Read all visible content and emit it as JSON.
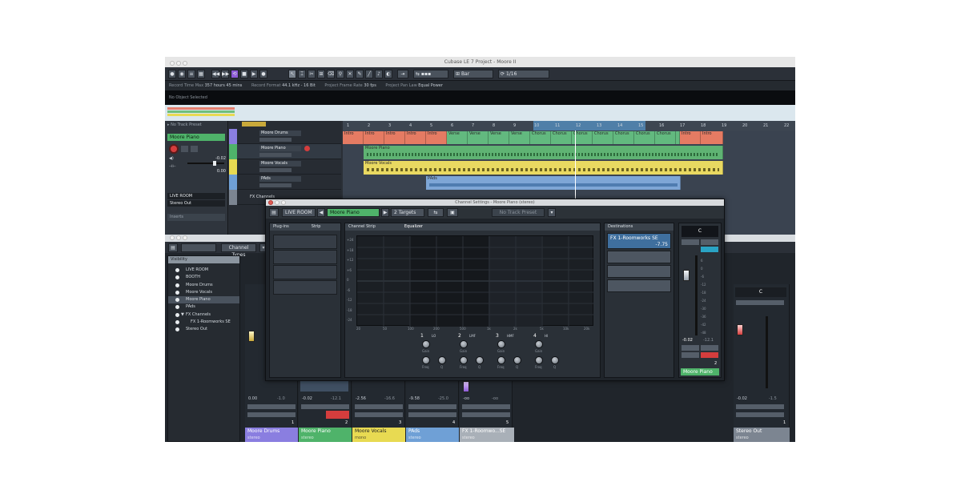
{
  "window": {
    "title": "Cubase LE 7 Project - Moore II"
  },
  "toolbar": {
    "snap_type": "Bar",
    "quantize": "1/16"
  },
  "info_line": {
    "items": [
      {
        "label": "Record Time Max",
        "value": "357 hours 45 mins"
      },
      {
        "label": "Record Format",
        "value": "44.1 kHz - 16 Bit"
      },
      {
        "label": "Project Frame Rate",
        "value": "30 fps"
      },
      {
        "label": "Project Pan Law",
        "value": "Equal Power"
      }
    ]
  },
  "object_selection": "No Object Selected",
  "inspector": {
    "preset": "No Track Preset",
    "track_name": "Moore Piano",
    "volume": "-0.02",
    "pan": "0.00",
    "routing_in": "LIVE ROOM",
    "routing_out": "Stereo Out",
    "inserts_label": "Inserts"
  },
  "tracks": [
    {
      "name": "Moore Drums",
      "color": "#8a7ee0"
    },
    {
      "name": "Moore Piano",
      "color": "#4fb36a"
    },
    {
      "name": "Moore Vocals",
      "color": "#e8da52"
    },
    {
      "name": "PAds",
      "color": "#6fa0d6"
    },
    {
      "name": "FX Channels",
      "color": "#7c8591"
    }
  ],
  "ruler": {
    "bars": [
      "1",
      "2",
      "3",
      "4",
      "5",
      "6",
      "7",
      "8",
      "9",
      "10",
      "11",
      "12",
      "13",
      "14",
      "15",
      "16",
      "17",
      "18",
      "19",
      "20",
      "21",
      "22"
    ]
  },
  "drum_parts": [
    "Intro",
    "Intro",
    "Intro",
    "Intro",
    "Intro",
    "Verse",
    "Verse",
    "Verse",
    "Verse",
    "Chorus",
    "Chorus",
    "Chorus",
    "Chorus",
    "Chorus",
    "Chorus",
    "Chorus",
    "Chorus",
    "Intro",
    "Intro"
  ],
  "piano_part": "Moore Piano",
  "vocals_part": "Moore Vocals",
  "pads_part": "PAds",
  "mixer": {
    "channel_types_label": "Channel Types",
    "visibility_title": "Visibility",
    "visibility_items": [
      "LIVE ROOM",
      "BOOTH",
      "Moore Drums",
      "Moore Vocals",
      "Moore Piano",
      "PAds",
      "FX Channels",
      "FX 1-Roomworks SE",
      "Stereo Out"
    ],
    "visibility_selected": 4,
    "channels": [
      {
        "name": "Moore Drums",
        "format": "stereo",
        "color": "#8a7ee0",
        "vol": "0.00",
        "peak": "-1.0",
        "num": "1"
      },
      {
        "name": "Moore Piano",
        "format": "stereo",
        "color": "#4fb36a",
        "vol": "-0.02",
        "peak": "-12.1",
        "num": "2"
      },
      {
        "name": "Moore Vocals",
        "format": "mono",
        "color": "#e8da52",
        "vol": "-2.56",
        "peak": "-16.6",
        "num": "3"
      },
      {
        "name": "PAds",
        "format": "stereo",
        "color": "#6fa0d6",
        "vol": "-9.58",
        "peak": "-25.0",
        "num": "4"
      },
      {
        "name": "FX 1-Roomwo...SE",
        "format": "stereo",
        "color": "#a9b0b8",
        "vol": "-oo",
        "peak": "-oo",
        "num": "5"
      }
    ],
    "stereo_out": {
      "name": "Stereo Out",
      "format": "stereo",
      "vol": "-0.02",
      "peak": "-1.5",
      "pan": "C",
      "num": "1"
    }
  },
  "channel_settings": {
    "title": "Channel Settings - Moore Piano (stereo)",
    "input": "LIVE ROOM",
    "channel": "Moore Piano",
    "targets": "2 Targets",
    "preset": "No Track Preset",
    "plugins_tab": "Plug-ins",
    "strip_tab": "Strip",
    "channel_strip_tab": "Channel Strip",
    "equalizer_tab": "Equalizer",
    "destinations_tab": "Destinations",
    "destination": {
      "name": "FX 1-Roomworks SE",
      "value": "-7.75"
    },
    "eq_db_labels": [
      "+24",
      "+18",
      "+12",
      "+6",
      "0",
      "-6",
      "-12",
      "-18",
      "-24"
    ],
    "eq_freq_labels": [
      "20",
      "50",
      "100",
      "200",
      "500",
      "1k",
      "2k",
      "5k",
      "10k",
      "20k"
    ],
    "bands": [
      {
        "num": "1",
        "type": "LO"
      },
      {
        "num": "2",
        "type": "LMF"
      },
      {
        "num": "3",
        "type": "HMF"
      },
      {
        "num": "4",
        "type": "HI"
      }
    ],
    "knob_labels": {
      "gain": "Gain",
      "freq": "Freq",
      "q": "Q"
    },
    "strip_pan": "C",
    "strip_vol": "-0.02",
    "strip_peak": "-12.1",
    "strip_num": "2",
    "strip_name": "Moore Piano",
    "meter_scale": [
      "6",
      "0",
      "-6",
      "-12",
      "-18",
      "-24",
      "-30",
      "-36",
      "-42",
      "-48"
    ]
  }
}
